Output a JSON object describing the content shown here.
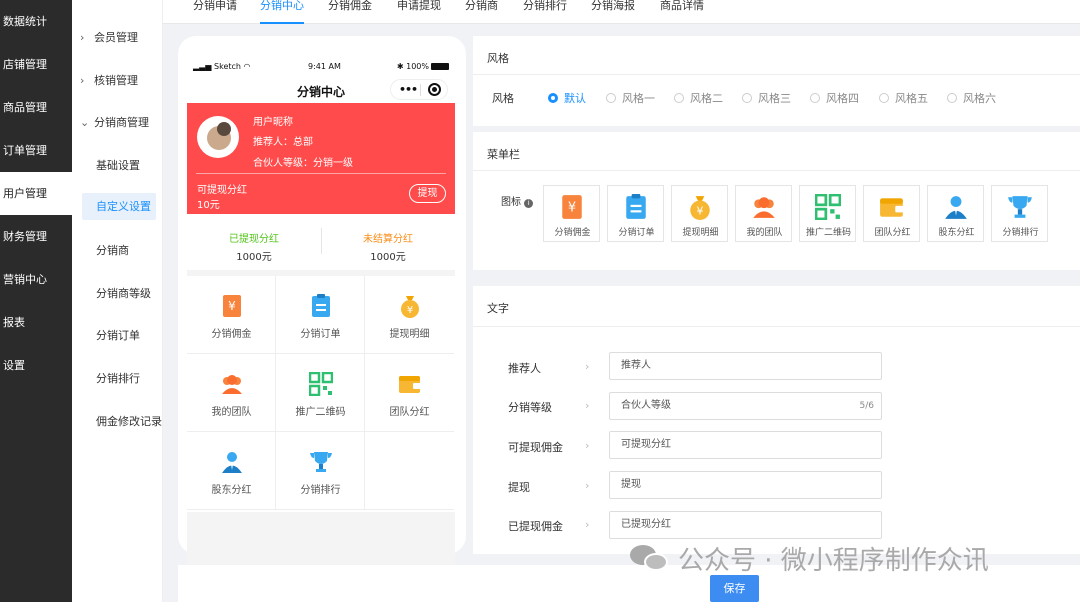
{
  "nav_primary": [
    {
      "label": "数据统计",
      "active": false
    },
    {
      "label": "店铺管理",
      "active": false
    },
    {
      "label": "商品管理",
      "active": false
    },
    {
      "label": "订单管理",
      "active": false
    },
    {
      "label": "用户管理",
      "active": true
    },
    {
      "label": "财务管理",
      "active": false
    },
    {
      "label": "营销中心",
      "active": false
    },
    {
      "label": "报表",
      "active": false
    },
    {
      "label": "设置",
      "active": false
    }
  ],
  "nav_secondary": {
    "member": "会员管理",
    "verify": "核销管理",
    "distributor_mgmt": "分销商管理",
    "basic": "基础设置",
    "custom": "自定义设置",
    "distributor": "分销商",
    "level": "分销商等级",
    "orders": "分销订单",
    "rank": "分销排行",
    "commission_log": "佣金修改记录"
  },
  "tabs": [
    "分销申请",
    "分销中心",
    "分销佣金",
    "申请提现",
    "分销商",
    "分销排行",
    "分销海报",
    "商品详情"
  ],
  "phone": {
    "status_left": "Sketch",
    "status_time": "9:41 AM",
    "status_right": "100%",
    "title": "分销中心",
    "capsule_dots": "•••",
    "user_name": "用户昵称",
    "referrer": "推荐人：总部",
    "level": "合伙人等级：分销一级",
    "withdrawable_label": "可提现分红",
    "withdrawable_value": "10元",
    "withdraw_btn": "提现",
    "withdrawn_label": "已提现分红",
    "withdrawn_value": "1000元",
    "unsettled_label": "未结算分红",
    "unsettled_value": "1000元",
    "grid": [
      "分销佣金",
      "分销订单",
      "提现明细",
      "我的团队",
      "推广二维码",
      "团队分红",
      "股东分红",
      "分销排行"
    ]
  },
  "style_panel": {
    "title": "风格",
    "label": "风格",
    "options": [
      "默认",
      "风格一",
      "风格二",
      "风格三",
      "风格四",
      "风格五",
      "风格六"
    ],
    "selected": "默认"
  },
  "menu_panel": {
    "title": "菜单栏",
    "icon_label": "图标",
    "icons": [
      "分销佣金",
      "分销订单",
      "提现明细",
      "我的团队",
      "推广二维码",
      "团队分红",
      "股东分红",
      "分销排行"
    ]
  },
  "text_panel": {
    "title": "文字",
    "rows": [
      {
        "label": "推荐人",
        "value": "推荐人",
        "count": ""
      },
      {
        "label": "分销等级",
        "value": "合伙人等级",
        "count": "5/6"
      },
      {
        "label": "可提现佣金",
        "value": "可提现分红",
        "count": ""
      },
      {
        "label": "提现",
        "value": "提现",
        "count": ""
      },
      {
        "label": "已提现佣金",
        "value": "已提现分红",
        "count": ""
      }
    ]
  },
  "save_label": "保存",
  "watermark": "公众号 · 微小程序制作众讯",
  "colors": {
    "accent": "#1890ff",
    "banner": "#ff4b4b",
    "withdrawn": "#52c41a",
    "unsettled": "#fa8c16",
    "save": "#3c8cf2"
  }
}
